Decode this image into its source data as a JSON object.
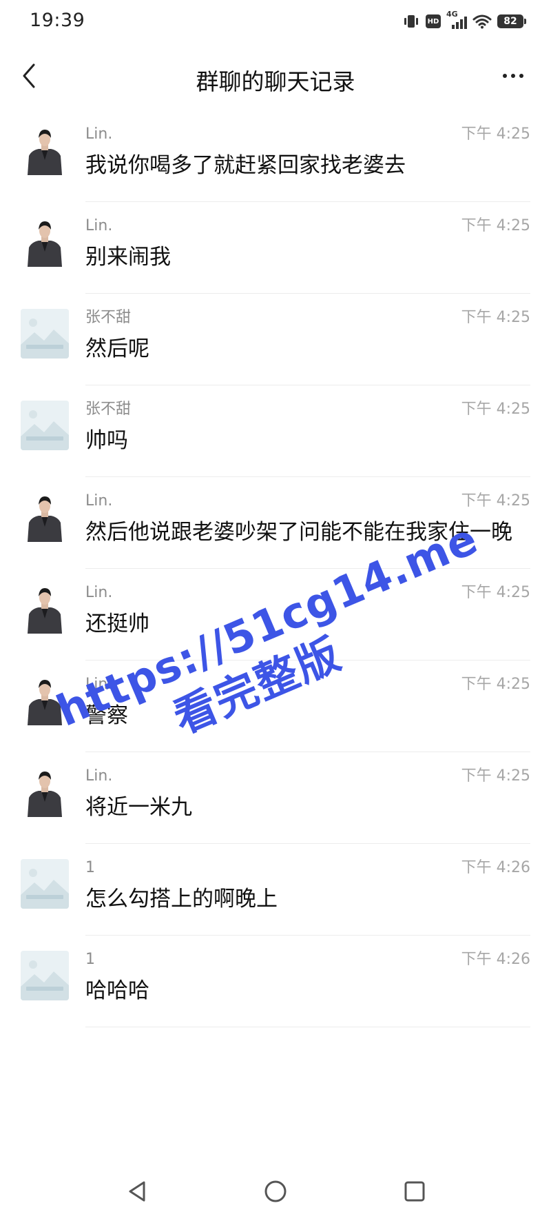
{
  "status_bar": {
    "time": "19:39",
    "hd_label": "HD",
    "network_label": "4G",
    "battery": "82"
  },
  "nav": {
    "title": "群聊的聊天记录",
    "back_icon": "chevron-left-icon",
    "more_icon": "more-horizontal-icon"
  },
  "messages": [
    {
      "sender": "Lin.",
      "time": "下午 4:25",
      "content": "我说你喝多了就赶紧回家找老婆去",
      "avatar": "person"
    },
    {
      "sender": "Lin.",
      "time": "下午 4:25",
      "content": "别来闹我",
      "avatar": "person"
    },
    {
      "sender": "张不甜",
      "time": "下午 4:25",
      "content": "然后呢",
      "avatar": "placeholder"
    },
    {
      "sender": "张不甜",
      "time": "下午 4:25",
      "content": "帅吗",
      "avatar": "placeholder"
    },
    {
      "sender": "Lin.",
      "time": "下午 4:25",
      "content": "然后他说跟老婆吵架了问能不能在我家住一晚",
      "avatar": "person"
    },
    {
      "sender": "Lin.",
      "time": "下午 4:25",
      "content": "还挺帅",
      "avatar": "person"
    },
    {
      "sender": "Lin.",
      "time": "下午 4:25",
      "content": "警察",
      "avatar": "person"
    },
    {
      "sender": "Lin.",
      "time": "下午 4:25",
      "content": "将近一米九",
      "avatar": "person"
    },
    {
      "sender": "1",
      "time": "下午 4:26",
      "content": "怎么勾搭上的啊晚上",
      "avatar": "placeholder"
    },
    {
      "sender": "1",
      "time": "下午 4:26",
      "content": "哈哈哈",
      "avatar": "placeholder"
    }
  ],
  "watermark": {
    "url": "https://51cg14.me",
    "subtitle": "看完整版"
  },
  "system_nav": {
    "back_icon": "triangle-back-icon",
    "home_icon": "circle-home-icon",
    "recents_icon": "square-recents-icon"
  },
  "colors": {
    "watermark": "#3d55e6",
    "meta_text": "#8c8c8c",
    "time_text": "#a6a6a6"
  }
}
